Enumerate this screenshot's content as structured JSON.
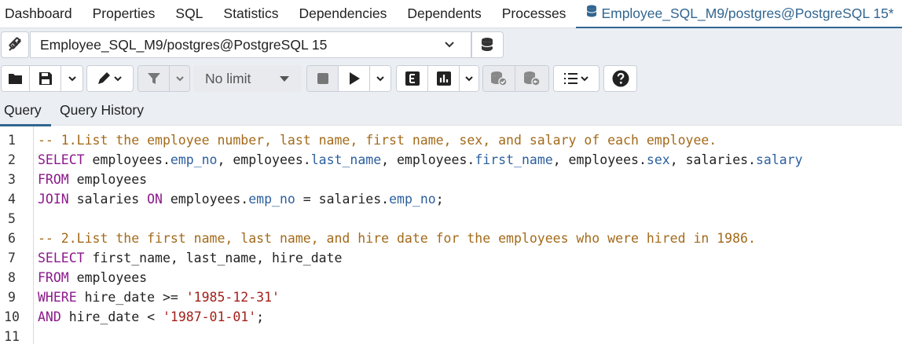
{
  "top_tabs": [
    "Dashboard",
    "Properties",
    "SQL",
    "Statistics",
    "Dependencies",
    "Dependents",
    "Processes"
  ],
  "active_tab": "Employee_SQL_M9/postgres@PostgreSQL 15*",
  "connection": "Employee_SQL_M9/postgres@PostgreSQL 15",
  "limit": "No limit",
  "query_tabs": [
    "Query",
    "Query History"
  ],
  "colors": {
    "accent": "#326690",
    "comment": "#a36a1a",
    "keyword": "#8b1a8b",
    "field": "#2c5f9e",
    "string": "#a3201a"
  },
  "icons": [
    "connection-status-icon",
    "database-icon",
    "folder-open-icon",
    "save-icon",
    "chevron-down-icon",
    "pencil-icon",
    "filter-icon",
    "stop-icon",
    "play-icon",
    "explain-icon",
    "explain-analyze-icon",
    "commit-icon",
    "rollback-icon",
    "macros-icon",
    "help-icon"
  ],
  "editor": {
    "lines": [
      {
        "n": "1",
        "t": [
          {
            "c": "cm",
            "v": "-- 1.List the employee number, last name, first name, sex, and salary of each employee."
          }
        ]
      },
      {
        "n": "2",
        "t": [
          {
            "c": "kw",
            "v": "SELECT"
          },
          {
            "c": "",
            "v": " employees."
          },
          {
            "c": "fld",
            "v": "emp_no"
          },
          {
            "c": "",
            "v": ", employees."
          },
          {
            "c": "fld",
            "v": "last_name"
          },
          {
            "c": "",
            "v": ", employees."
          },
          {
            "c": "fld",
            "v": "first_name"
          },
          {
            "c": "",
            "v": ", employees."
          },
          {
            "c": "fld",
            "v": "sex"
          },
          {
            "c": "",
            "v": ", salaries."
          },
          {
            "c": "fld",
            "v": "salary"
          }
        ]
      },
      {
        "n": "3",
        "t": [
          {
            "c": "kw",
            "v": "FROM"
          },
          {
            "c": "",
            "v": " employees"
          }
        ]
      },
      {
        "n": "4",
        "t": [
          {
            "c": "kw",
            "v": "JOIN"
          },
          {
            "c": "",
            "v": " salaries "
          },
          {
            "c": "kw",
            "v": "ON"
          },
          {
            "c": "",
            "v": " employees."
          },
          {
            "c": "fld",
            "v": "emp_no"
          },
          {
            "c": "",
            "v": " = salaries."
          },
          {
            "c": "fld",
            "v": "emp_no"
          },
          {
            "c": "",
            "v": ";"
          }
        ]
      },
      {
        "n": "5",
        "t": []
      },
      {
        "n": "6",
        "t": [
          {
            "c": "cm",
            "v": "-- 2.List the first name, last name, and hire date for the employees who were hired in 1986."
          }
        ]
      },
      {
        "n": "7",
        "t": [
          {
            "c": "kw",
            "v": "SELECT"
          },
          {
            "c": "",
            "v": " first_name, last_name, hire_date"
          }
        ]
      },
      {
        "n": "8",
        "t": [
          {
            "c": "kw",
            "v": "FROM"
          },
          {
            "c": "",
            "v": " employees"
          }
        ]
      },
      {
        "n": "9",
        "t": [
          {
            "c": "kw",
            "v": "WHERE"
          },
          {
            "c": "",
            "v": " hire_date >= "
          },
          {
            "c": "str",
            "v": "'1985-12-31'"
          }
        ]
      },
      {
        "n": "10",
        "t": [
          {
            "c": "kw",
            "v": "AND"
          },
          {
            "c": "",
            "v": " hire_date < "
          },
          {
            "c": "str",
            "v": "'1987-01-01'"
          },
          {
            "c": "",
            "v": ";"
          }
        ]
      },
      {
        "n": "11",
        "t": []
      }
    ]
  }
}
